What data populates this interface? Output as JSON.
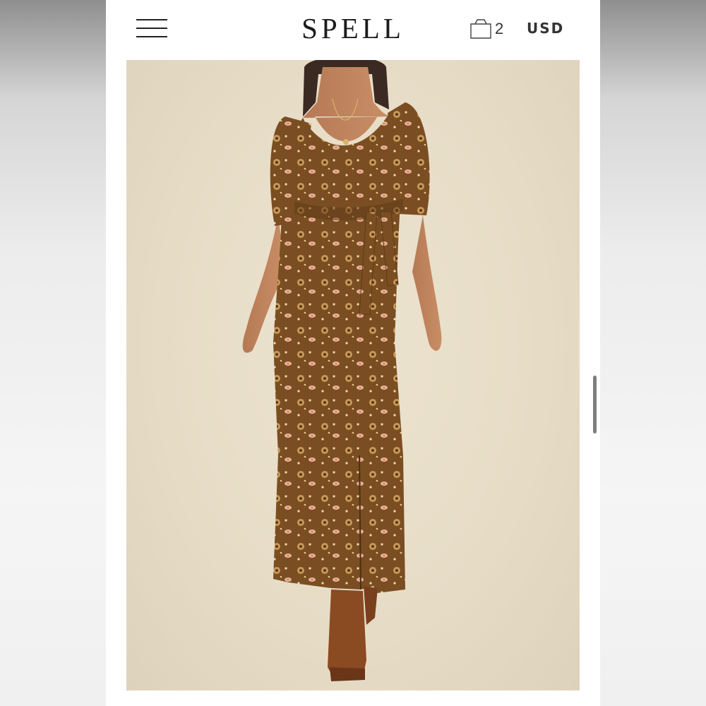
{
  "header": {
    "brand": "SPELL",
    "cart_count": "2",
    "currency": "USD",
    "menu_icon": "hamburger-icon",
    "cart_icon": "shopping-bag-icon"
  },
  "colors": {
    "background": "#ffffff",
    "photo_backdrop": "#e6dcc6",
    "dress_base": "#7a4e22",
    "boots": "#8a4a22",
    "text": "#1c1c1c"
  }
}
